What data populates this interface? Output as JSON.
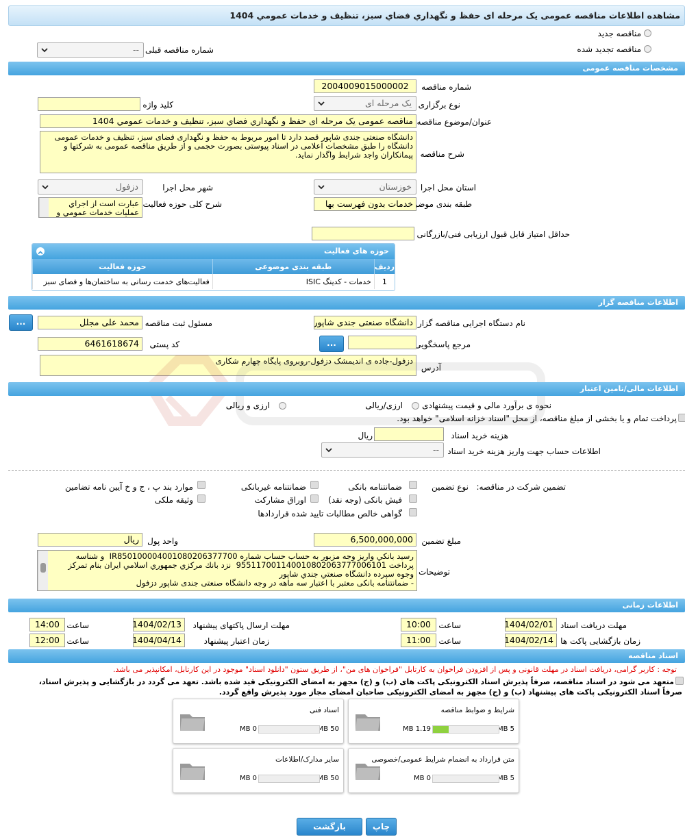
{
  "title": "مشاهده اطلاعات مناقصه عمومی یک مرحله ای حفظ و نگهداري فضاي سبز، تنظيف و خدمات عمومي 1404",
  "top": {
    "radio_new": "مناقصه جدید",
    "radio_renewed": "مناقصه تجدید شده",
    "prev_label": "شماره مناقصه قبلی",
    "prev_value": "--"
  },
  "general": {
    "header": "مشخصات مناقصه عمومی",
    "number_label": "شماره مناقصه",
    "number_value": "2004009015000002",
    "type_label": "نوع برگزاری",
    "type_value": "یک مرحله ای",
    "keyword_label": "کلید واژه",
    "keyword_value": "",
    "subject_label": "عنوان/موضوع مناقصه",
    "subject_value": "مناقصه عمومی یک مرحله ای حفظ و نگهداري فضاي سبز، تنظيف و خدمات عمومي 1404",
    "desc_label": "شرح مناقصه",
    "desc_value": "دانشگاه صنعتی جندی شاپور قصد دارد تا امور مربوط به حفظ و نگهداری فضای سبز، تنظیف و خدمات عمومی دانشگاه را طبق مشخصات اعلامی در اسناد پیوستی بصورت حجمی و از طریق مناقصه عمومی به شرکتها و پیمانکاران واجد شرایط واگذار نماید.",
    "province_label": "استان محل اجرا",
    "province_value": "خوزستان",
    "city_label": "شهر محل اجرا",
    "city_value": "دزفول",
    "category_label": "طبقه بندی موضوعی",
    "category_value": "خدمات بدون فهرست بها",
    "scope_label": "شرح کلی حوزه فعالیت",
    "scope_value": "عبارت است از اجراي عمليات خدمات عمومي و",
    "min_score_label": "حداقل امتیاز قابل قبول ارزیابی فنی/بازرگانی",
    "min_score_value": ""
  },
  "activity": {
    "title": "حوزه های فعالیت",
    "col_row": "ردیف",
    "col_category": "طبقه بندی موضوعی",
    "col_field": "حوزه فعالیت",
    "rows": [
      {
        "n": "1",
        "category": "خدمات - کدینگ ISIC",
        "field": "فعالیت‌های خدمت رسانی به ساختمان‌ها و فضای سبز"
      }
    ]
  },
  "organizer": {
    "header": "اطلاعات مناقصه گزار",
    "org_label": "نام دستگاه اجرایی مناقصه گزار",
    "org_value": "دانشگاه صنعتی جندی شاپور",
    "reg_label": "مسئول ثبت مناقصه",
    "reg_value": "محمد علی مجلل",
    "ref_label": "مرجع پاسخگویی",
    "ref_value": "",
    "postal_label": "کد پستی",
    "postal_value": "6461618674",
    "addr_label": "آدرس",
    "addr_value": "دزفول-جاده ی اندیمشک دزفول-روبروی پایگاه چهارم شکاری",
    "more_btn": "..."
  },
  "finance": {
    "header": "اطلاعات مالی/تامین اعتبار",
    "estimate_label": "نحوه ی برآورد مالی و قیمت پیشنهادی",
    "opt_rial_fx": "ارزی/ریالی",
    "opt_fx_and_rial": "ارزی و ریالی",
    "treasury_text": "پرداخت تمام و یا بخشی از مبلغ مناقصه، از محل \"اسناد خزانه اسلامی\" خواهد بود.",
    "fee_label": "هزینه خرید اسناد",
    "fee_value": "",
    "fee_unit": "ریال",
    "account_label": "اطلاعات حساب جهت واریز هزینه خرید اسناد",
    "account_value": "--"
  },
  "guarantee": {
    "section_label": "تضمین شرکت در مناقصه:",
    "type_label": "نوع تضمین",
    "opt_bank_guarantee": "ضمانتنامه بانکی",
    "opt_nonbank_guarantee": "ضمانتنامه غیربانکی",
    "opt_articles": "موارد بند پ ، ج و خ آیین نامه تضامین",
    "opt_bank_receipt": "فیش بانکی (وجه نقد)",
    "opt_partnership_bonds": "اوراق مشارکت",
    "opt_property": "وثیقه ملکی",
    "opt_receivables": "گواهی خالص مطالبات تایید شده قراردادها",
    "amount_label": "مبلغ تضمین",
    "amount_value": "6,500,000,000",
    "currency_label": "واحد پول",
    "currency_value": "ریال",
    "notes_label": "توضیحات",
    "notes_value": "رسيد بانكي واريز وجه مزبور به حساب حساب شماره IR850100004001080206377700  و شناسه پرداخت 955117001140010802063777006101  نزد بانك مركزي جمهوري اسلامي ايران بنام تمركز وجوه سپرده دانشگاه صنعتي جندي شاپور\n- ضمانتنامه بانکی معتبر با اعتبار سه ماهه در وجه دانشگاه صنعتی جندی شاپور دزفول"
  },
  "timing": {
    "header": "اطلاعات زمانی",
    "receive_deadline_label": "مهلت دریافت اسناد",
    "receive_deadline_date": "1404/02/01",
    "receive_deadline_time": "10:00",
    "send_deadline_label": "مهلت ارسال پاکتهای پیشنهاد",
    "send_deadline_date": "1404/02/13",
    "send_deadline_time": "14:00",
    "opening_label": "زمان بازگشایی پاکت ها",
    "opening_date": "1404/02/14",
    "opening_time": "11:00",
    "validity_label": "زمان اعتبار پیشنهاد",
    "validity_date": "1404/04/14",
    "validity_time": "12:00",
    "time_label": "ساعت"
  },
  "documents": {
    "header": "اسناد مناقصه",
    "note_red": "توجه : کاربر گرامی، دریافت اسناد در مهلت قانونی و پس از افزودن فراخوان به کارتابل \"فراخوان های من\"، از طریق ستون \"دانلود اسناد\" موجود در این کارتابل، امکانپذیر می باشد.",
    "commit_line1": "متعهد می شود در اسناد مناقصه، صرفاً پذیرش اسناد الکترونیکی پاکت های (ب) و (ج) مجهز به امضای الکترونیکی قید شده باشد. تعهد می گردد در بازگشایی و پذیرش اسناد،",
    "commit_line2": "صرفاً اسناد الکترونیکی پاکت های پیشنهاد (ب) و (ج) مجهز به امضای الکترونیکی صاحبان امضای مجاز مورد پذیرش واقع گردد.",
    "cards": [
      {
        "name": "شرایط و ضوابط مناقصه",
        "used": "1.19 MB",
        "max": "5 MB",
        "fill": 0.24
      },
      {
        "name": "اسناد فنی",
        "used": "0 MB",
        "max": "50 MB",
        "fill": 0
      },
      {
        "name": "متن قرارداد به انضمام شرایط عمومی/خصوصی",
        "used": "0 MB",
        "max": "5 MB",
        "fill": 0
      },
      {
        "name": "سایر مدارک/اطلاعات",
        "used": "0 MB",
        "max": "50 MB",
        "fill": 0
      }
    ]
  },
  "actions": {
    "print": "چاپ",
    "back": "بازگشت"
  },
  "colors": {
    "section_header": "#45a4df",
    "input_bg": "#ffffc2",
    "notice_red": "#e00000",
    "progress_green": "#8fd13f"
  }
}
